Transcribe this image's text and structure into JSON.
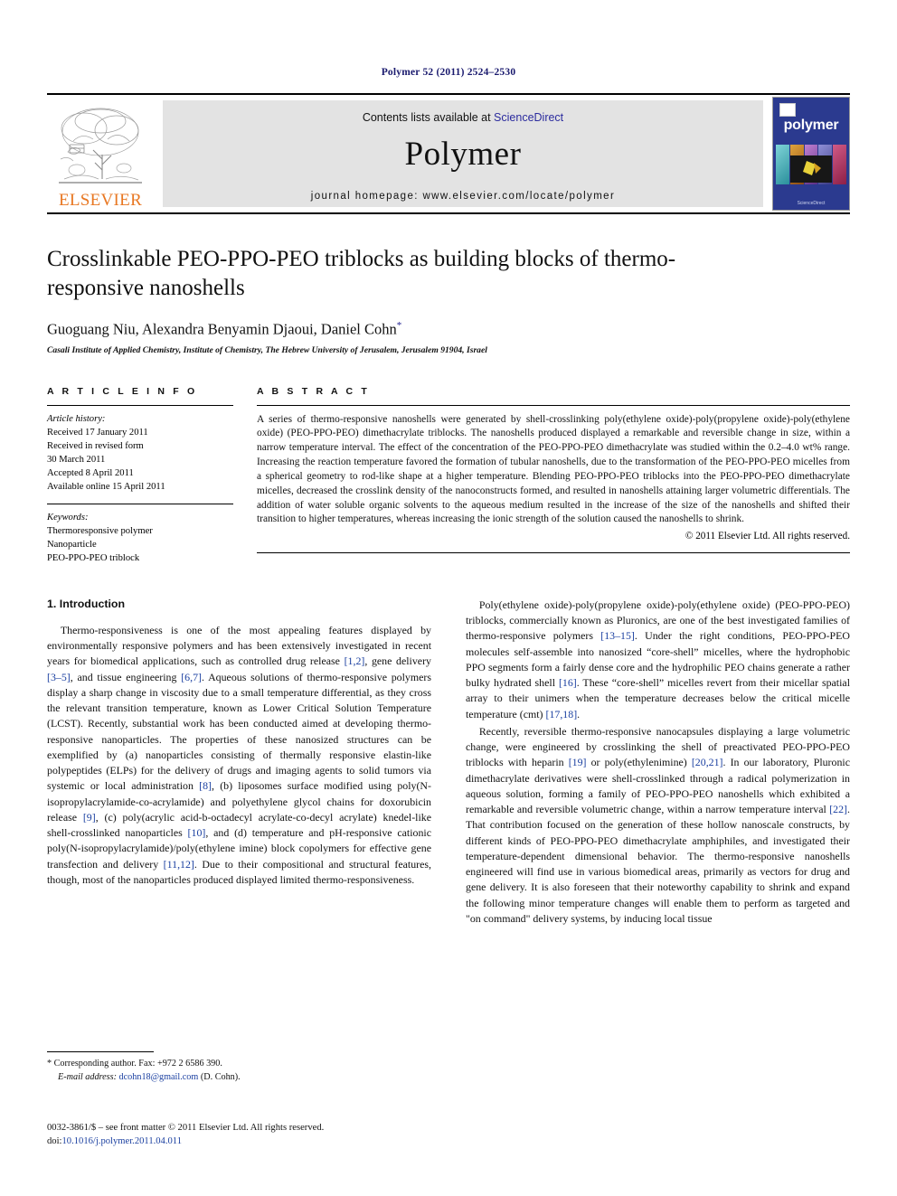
{
  "running_head": "Polymer 52 (2011) 2524–2530",
  "masthead": {
    "publisher_name": "ELSEVIER",
    "contents_prefix": "Contents lists available at ",
    "sciencedirect": "ScienceDirect",
    "journal_name": "Polymer",
    "homepage": "journal homepage: www.elsevier.com/locate/polymer",
    "cover": {
      "title": "polymer",
      "footer": "ScienceDirect"
    },
    "colors": {
      "elsevier_orange": "#E87722",
      "link_blue": "#2b2b9e",
      "cover_blue": "#2b3a8f",
      "banner_gray": "#e3e3e3"
    }
  },
  "article": {
    "title": "Crosslinkable PEO-PPO-PEO triblocks as building blocks of thermo-responsive nanoshells",
    "authors": "Guoguang Niu, Alexandra Benyamin Djaoui, Daniel Cohn",
    "corresponding_marker": "*",
    "affiliation": "Casali Institute of Applied Chemistry, Institute of Chemistry, The Hebrew University of Jerusalem, Jerusalem 91904, Israel"
  },
  "article_info": {
    "heading": "A R T I C L E   I N F O",
    "history_label": "Article history:",
    "history": [
      "Received 17 January 2011",
      "Received in revised form",
      "30 March 2011",
      "Accepted 8 April 2011",
      "Available online 15 April 2011"
    ],
    "keywords_label": "Keywords:",
    "keywords": [
      "Thermoresponsive polymer",
      "Nanoparticle",
      "PEO-PPO-PEO triblock"
    ]
  },
  "abstract": {
    "heading": "A B S T R A C T",
    "text": "A series of thermo-responsive nanoshells were generated by shell-crosslinking poly(ethylene oxide)-poly(propylene oxide)-poly(ethylene oxide) (PEO-PPO-PEO) dimethacrylate triblocks. The nanoshells produced displayed a remarkable and reversible change in size, within a narrow temperature interval. The effect of the concentration of the PEO-PPO-PEO dimethacrylate was studied within the 0.2–4.0 wt% range. Increasing the reaction temperature favored the formation of tubular nanoshells, due to the transformation of the PEO-PPO-PEO micelles from a spherical geometry to rod-like shape at a higher temperature. Blending PEO-PPO-PEO triblocks into the PEO-PPO-PEO dimethacrylate micelles, decreased the crosslink density of the nanoconstructs formed, and resulted in nanoshells attaining larger volumetric differentials. The addition of water soluble organic solvents to the aqueous medium resulted in the increase of the size of the nanoshells and shifted their transition to higher temperatures, whereas increasing the ionic strength of the solution caused the nanoshells to shrink.",
    "copyright": "© 2011 Elsevier Ltd. All rights reserved."
  },
  "introduction": {
    "heading": "1.  Introduction",
    "left_paragraphs": [
      "Thermo-responsiveness is one of the most appealing features displayed by environmentally responsive polymers and has been extensively investigated in recent years for biomedical applications, such as controlled drug release [1,2], gene delivery [3–5], and tissue engineering [6,7]. Aqueous solutions of thermo-responsive polymers display a sharp change in viscosity due to a small temperature differential, as they cross the relevant transition temperature, known as Lower Critical Solution Temperature (LCST). Recently, substantial work has been conducted aimed at developing thermo-responsive nanoparticles. The properties of these nanosized structures can be exemplified by (a) nanoparticles consisting of thermally responsive elastin-like polypeptides (ELPs) for the delivery of drugs and imaging agents to solid tumors via systemic or local administration [8], (b) liposomes surface modified using poly(N-isopropylacrylamide-co-acrylamide) and polyethylene glycol chains for doxorubicin release [9], (c) poly(acrylic acid-b-octadecyl acrylate-co-decyl acrylate) knedel-like shell-crosslinked nanoparticles [10], and (d) temperature and pH-responsive cationic poly(N-isopropylacrylamide)/poly(ethylene imine) block copolymers for effective gene transfection and delivery [11,12]. Due to their compositional and structural features, though, most of the nanoparticles produced displayed limited thermo-responsiveness."
    ],
    "right_paragraphs": [
      "Poly(ethylene oxide)-poly(propylene oxide)-poly(ethylene oxide) (PEO-PPO-PEO) triblocks, commercially known as Pluronics, are one of the best investigated families of thermo-responsive polymers [13–15]. Under the right conditions, PEO-PPO-PEO molecules self-assemble into nanosized “core-shell” micelles, where the hydrophobic PPO segments form a fairly dense core and the hydrophilic PEO chains generate a rather bulky hydrated shell [16]. These “core-shell” micelles revert from their micellar spatial array to their unimers when the temperature decreases below the critical micelle temperature (cmt) [17,18].",
      "Recently, reversible thermo-responsive nanocapsules displaying a large volumetric change, were engineered by crosslinking the shell of preactivated PEO-PPO-PEO triblocks with heparin [19] or poly(ethylenimine) [20,21]. In our laboratory, Pluronic dimethacrylate derivatives were shell-crosslinked through a radical polymerization in aqueous solution, forming a family of PEO-PPO-PEO nanoshells which exhibited a remarkable and reversible volumetric change, within a narrow temperature interval [22]. That contribution focused on the generation of these hollow nanoscale constructs, by different kinds of PEO-PPO-PEO dimethacrylate amphiphiles, and investigated their temperature-dependent dimensional behavior. The thermo-responsive nanoshells engineered will find use in various biomedical areas, primarily as vectors for drug and gene delivery. It is also foreseen that their noteworthy capability to shrink and expand the following minor temperature changes will enable them to perform as targeted and \"on command\" delivery systems, by inducing local tissue"
    ]
  },
  "footnotes": {
    "corresponding": "* Corresponding author. Fax: +972 2 6586 390.",
    "email_label": "E-mail address:",
    "email": "dcohn18@gmail.com",
    "email_suffix": "(D. Cohn)."
  },
  "imprint": {
    "line1": "0032-3861/$ – see front matter © 2011 Elsevier Ltd. All rights reserved.",
    "doi_label": "doi:",
    "doi": "10.1016/j.polymer.2011.04.011"
  }
}
